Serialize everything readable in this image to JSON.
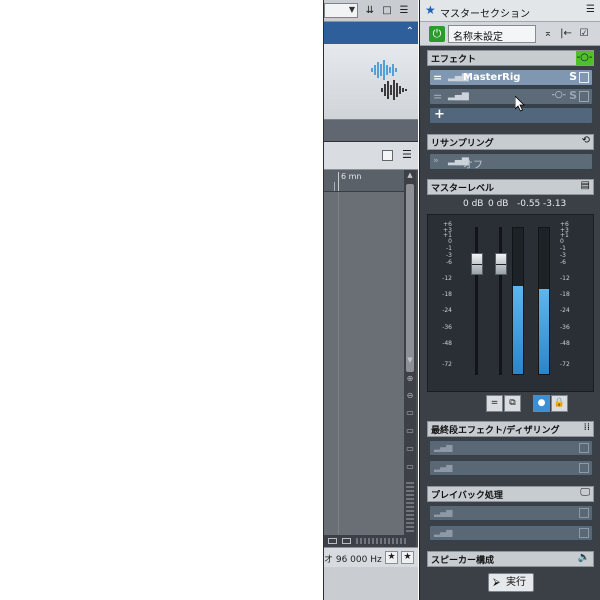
{
  "master": {
    "title": "マスターセクション",
    "preset_name": "名称未設定",
    "effects": {
      "header": "エフェクト",
      "slots": [
        {
          "name": "MasterRig",
          "solo": "S"
        },
        {
          "name": "",
          "solo": "S"
        }
      ],
      "add_symbol": "+"
    },
    "resampling": {
      "header": "リサンプリング",
      "value": "オフ"
    },
    "master_level": {
      "header": "マスターレベル",
      "readouts": [
        "0 dB",
        "0 dB",
        "-0.55",
        "-3.13"
      ],
      "scale_left": [
        "+6",
        "+3",
        "+1",
        "0",
        "-1",
        "-3",
        "-6",
        "-12",
        "-18",
        "-24",
        "-36",
        "-48",
        "-72"
      ],
      "scale_right": [
        "+6",
        "+3",
        "+1",
        "0",
        "-1",
        "-3",
        "-6",
        "-12",
        "-18",
        "-24",
        "-36",
        "-48",
        "-72"
      ],
      "meter_left_level": 0.6,
      "meter_right_level": 0.58
    },
    "final_effects": {
      "header": "最終段エフェクト/ディザリング"
    },
    "playback": {
      "header": "プレイバック処理"
    },
    "speakers": {
      "header": "スピーカー構成"
    },
    "execute_label": "実行"
  },
  "left": {
    "ruler_label": "6 mn",
    "status_text": "オ 96 000 Hz"
  },
  "colors": {
    "power_green": "#2d9a2d",
    "meter_blue": "#3a9ee0",
    "title_star": "#1e63b8"
  }
}
